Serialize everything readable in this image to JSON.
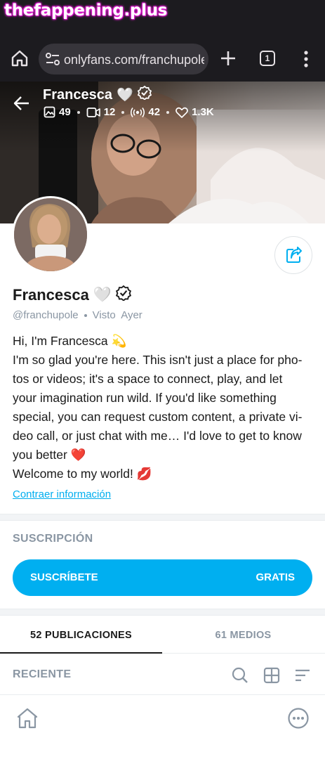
{
  "watermark": "thefappening.plus",
  "browser": {
    "url": "onlyfans.com/franchupole",
    "tab_count": "1"
  },
  "cover": {
    "name": "Francesca",
    "name_emoji": "🤍",
    "stats": {
      "photos": "49",
      "videos": "12",
      "streams": "42",
      "likes": "1.3K"
    }
  },
  "profile": {
    "name": "Francesca",
    "name_emoji": "🤍",
    "handle": "@franchupole",
    "last_seen": "Visto  Ayer",
    "bio_lines": [
      "Hi, I'm Francesca 💫",
      "I'm so glad you're here. This isn't just a place for pho-",
      "tos or videos; it's a space to connect, play, and let",
      "your imagination run wild. If you'd like something",
      "special, you can request custom content, a private vi-",
      "deo call, or just chat with me… I'd love to get to know",
      "you better ❤️",
      "Welcome to my world! 💋"
    ],
    "collapse_label": "Contraer información"
  },
  "subscription": {
    "title": "SUSCRIPCIÓN",
    "button_label": "SUSCRÍBETE",
    "price_label": "GRATIS"
  },
  "tabs": [
    {
      "label": "52 PUBLICACIONES",
      "active": true
    },
    {
      "label": "61 MEDIOS",
      "active": false
    }
  ],
  "feed": {
    "sort_label": "RECIENTE"
  },
  "colors": {
    "accent": "#00aff0",
    "muted": "#8a96a3",
    "browser_bg": "#1c1b1f"
  }
}
